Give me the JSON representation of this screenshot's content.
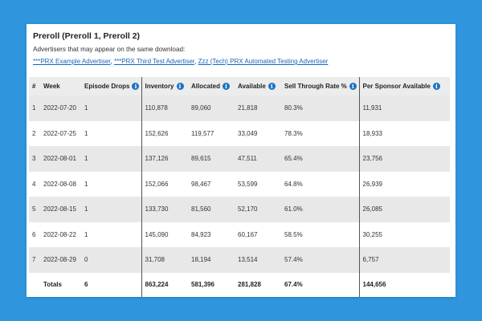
{
  "header": {
    "title": "Preroll (Preroll 1, Preroll 2)",
    "subtitle": "Advertisers that may appear on the same download:"
  },
  "advertisers": [
    "***PRX Example Advertiser",
    "***PRX Third Test Advertiser",
    "Zzz (Tech) PRX Automated Testing Advertiser"
  ],
  "table": {
    "columns": [
      "#",
      "Week",
      "Episode Drops",
      "Inventory",
      "Allocated",
      "Available",
      "Sell Through Rate %",
      "Per Sponsor Available"
    ],
    "info_icon": "info-icon",
    "rows": [
      [
        "1",
        "2022-07-20",
        "1",
        "110,878",
        "89,060",
        "21,818",
        "80.3%",
        "11,931"
      ],
      [
        "2",
        "2022-07-25",
        "1",
        "152,626",
        "119,577",
        "33,049",
        "78.3%",
        "18,933"
      ],
      [
        "3",
        "2022-08-01",
        "1",
        "137,126",
        "89,615",
        "47,511",
        "65.4%",
        "23,756"
      ],
      [
        "4",
        "2022-08-08",
        "1",
        "152,066",
        "98,467",
        "53,599",
        "64.8%",
        "26,939"
      ],
      [
        "5",
        "2022-08-15",
        "1",
        "133,730",
        "81,560",
        "52,170",
        "61.0%",
        "26,085"
      ],
      [
        "6",
        "2022-08-22",
        "1",
        "145,090",
        "84,923",
        "60,167",
        "58.5%",
        "30,255"
      ],
      [
        "7",
        "2022-08-29",
        "0",
        "31,708",
        "18,194",
        "13,514",
        "57.4%",
        "6,757"
      ]
    ],
    "totals": [
      "Totals",
      "6",
      "863,224",
      "581,396",
      "281,828",
      "67.4%",
      "144,656"
    ]
  },
  "colors": {
    "background": "#2f95dc",
    "link": "#1565c0",
    "info_icon": "#1a73c2",
    "striped_row": "#e8e8e8"
  }
}
